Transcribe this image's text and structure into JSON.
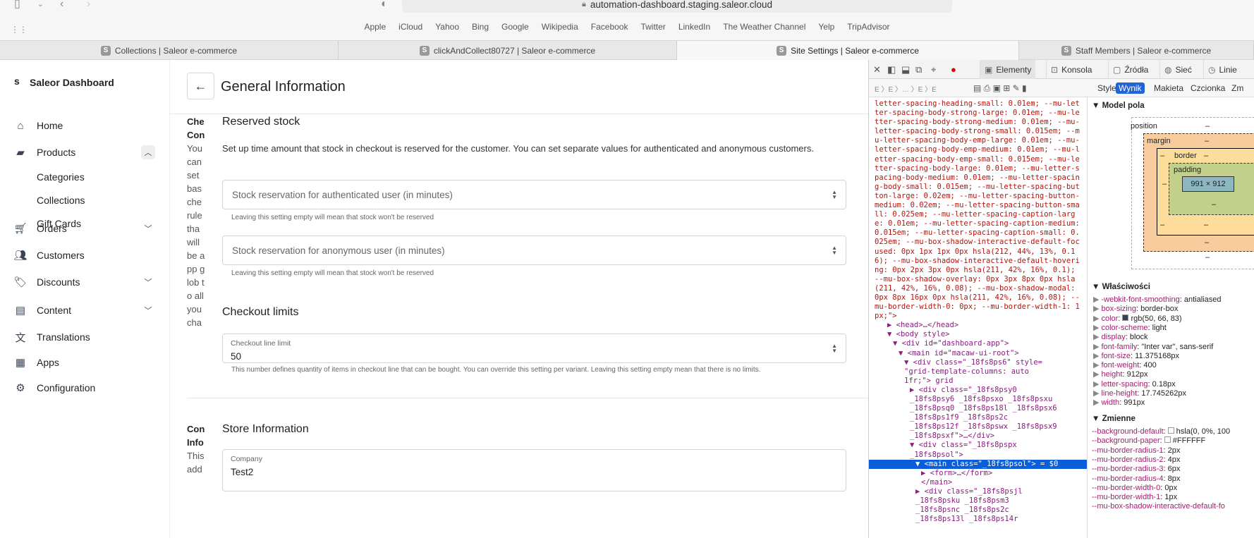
{
  "browser": {
    "url": "automation-dashboard.staging.saleor.cloud",
    "bookmarks": [
      "Apple",
      "iCloud",
      "Yahoo",
      "Bing",
      "Google",
      "Wikipedia",
      "Facebook",
      "Twitter",
      "LinkedIn",
      "The Weather Channel",
      "Yelp",
      "TripAdvisor"
    ],
    "tabs": [
      {
        "label": "Collections | Saleor e-commerce",
        "active": false
      },
      {
        "label": "clickAndCollect80727 | Saleor e-commerce",
        "active": false
      },
      {
        "label": "Site Settings | Saleor e-commerce",
        "active": true
      },
      {
        "label": "Staff Members | Saleor e-commerce",
        "active": false
      }
    ],
    "favicon_letter": "S"
  },
  "sidebar": {
    "brand": "Saleor Dashboard",
    "items": [
      {
        "label": "Home",
        "icon": "home-icon"
      },
      {
        "label": "Products",
        "icon": "folder-icon",
        "expanded": true
      },
      {
        "label": "Orders",
        "icon": "cart-icon"
      },
      {
        "label": "Customers",
        "icon": "users-icon"
      },
      {
        "label": "Discounts",
        "icon": "tag-icon"
      },
      {
        "label": "Content",
        "icon": "content-icon"
      },
      {
        "label": "Translations",
        "icon": "translate-icon"
      },
      {
        "label": "Apps",
        "icon": "apps-icon"
      },
      {
        "label": "Configuration",
        "icon": "gear-icon"
      }
    ],
    "subitems": [
      "Categories",
      "Collections",
      "Gift Cards"
    ]
  },
  "main": {
    "title": "General Information",
    "left_partial_1": {
      "heading": "Che Con",
      "body": "You can set bas che rule tha will be app glob to all you cha"
    },
    "left_partial_2": {
      "heading": "Con Info",
      "body": "This add"
    },
    "reserved": {
      "title": "Reserved stock",
      "desc": "Set up time amount that stock in checkout is reserved for the customer. You can set separate values for authenticated and anonymous customers.",
      "auth_placeholder": "Stock reservation for authenticated user (in minutes)",
      "anon_placeholder": "Stock reservation for anonymous user (in minutes)",
      "help": "Leaving this setting empty will mean that stock won't be reserved"
    },
    "limits": {
      "title": "Checkout limits",
      "label": "Checkout line limit",
      "value": "50",
      "help": "This number defines quantity of items in checkout line that can be bought. You can override this setting per variant. Leaving this setting empty mean that there is no limits."
    },
    "store": {
      "title": "Store Information",
      "company_label": "Company",
      "company_value": "Test2"
    }
  },
  "devtools": {
    "tabs": [
      "Elementy",
      "Konsola",
      "Źródła",
      "Sieć",
      "Linie"
    ],
    "panel_tabs": [
      "Style",
      "Wynik",
      "Makieta",
      "Czcionka",
      "Zm"
    ],
    "css_text": "letter-spacing-heading-small: 0.01em; --mu-letter-spacing-body-strong-large: 0.01em; --mu-letter-spacing-body-strong-medium: 0.01em; --mu-letter-spacing-body-strong-small: 0.015em; --mu-letter-spacing-body-emp-large: 0.01em; --mu-letter-spacing-body-emp-medium: 0.01em; --mu-letter-spacing-body-emp-small: 0.015em; --mu-letter-spacing-body-large: 0.01em; --mu-letter-spacing-body-medium: 0.01em; --mu-letter-spacing-body-small: 0.015em; --mu-letter-spacing-button-large: 0.02em; --mu-letter-spacing-button-medium: 0.02em; --mu-letter-spacing-button-small: 0.025em; --mu-letter-spacing-caption-large: 0.01em; --mu-letter-spacing-caption-medium: 0.015em; --mu-letter-spacing-caption-small: 0.025em; --mu-box-shadow-interactive-default-focused: 0px 1px 1px 0px hsla(212, 44%, 13%, 0.16); --mu-box-shadow-interactive-default-hovering: 0px 2px 3px 0px hsla(211, 42%, 16%, 0.1); --mu-box-shadow-overlay: 0px 3px 8px 0px hsla(211, 42%, 16%, 0.08); --mu-box-shadow-modal: 0px 8px 16px 0px hsla(211, 42%, 16%, 0.08); --mu-border-width-0: 0px; --mu-border-width-1: 1px;\">",
    "dom_lines": [
      {
        "text": "▶ <head>…</head>",
        "indent": 2,
        "sel": false
      },
      {
        "text": "▼ <body style>",
        "indent": 2,
        "sel": false
      },
      {
        "text": "▼ <div id=\"dashboard-app\">",
        "indent": 3,
        "sel": false
      },
      {
        "text": "▼ <main id=\"macaw-ui-root\">",
        "indent": 4,
        "sel": false
      },
      {
        "text": "▼ <div class=\"_18fs8ps6\" style=",
        "indent": 5,
        "sel": false
      },
      {
        "text": "\"grid-template-columns: auto",
        "indent": 5,
        "sel": false
      },
      {
        "text": "1fr;\"> grid",
        "indent": 5,
        "sel": false
      },
      {
        "text": "▶ <div class=\"_18fs8psy0",
        "indent": 6,
        "sel": false
      },
      {
        "text": "_18fs8psy6 _18fs8psxo _18fs8psxu",
        "indent": 6,
        "sel": false
      },
      {
        "text": "_18fs8psq0 _18fs8ps18l _18fs8psx6",
        "indent": 6,
        "sel": false
      },
      {
        "text": "_18fs8ps1f9 _18fs8ps2c",
        "indent": 6,
        "sel": false
      },
      {
        "text": "_18fs8ps12f _18fs8pswx _18fs8psx9",
        "indent": 6,
        "sel": false
      },
      {
        "text": "_18fs8psxf\">…</div>",
        "indent": 6,
        "sel": false
      },
      {
        "text": "▼ <div class=\"_18fs8pspx",
        "indent": 6,
        "sel": false
      },
      {
        "text": "_18fs8psol\">",
        "indent": 6,
        "sel": false
      },
      {
        "text": "▼ <main class=\"_18fs8psol\"> = $0",
        "indent": 7,
        "sel": true
      },
      {
        "text": "▶ <form>…</form>",
        "indent": 8,
        "sel": false
      },
      {
        "text": "</main>",
        "indent": 8,
        "sel": false
      },
      {
        "text": "▶ <div class=\"_18fs8psjl",
        "indent": 7,
        "sel": false
      },
      {
        "text": "_18fs8psku _18fs8psm3",
        "indent": 7,
        "sel": false
      },
      {
        "text": "_18fs8psnc _18fs8ps2c",
        "indent": 7,
        "sel": false
      },
      {
        "text": "_18fs8ps13l _18fs8ps14r",
        "indent": 7,
        "sel": false
      }
    ],
    "box_model": {
      "position": "position",
      "margin": "margin",
      "border": "border",
      "padding": "padding",
      "size": "991 × 912",
      "dash": "–"
    },
    "computed_title": "Właściwości",
    "box_title": "Model pola",
    "computed": [
      {
        "k": "-webkit-font-smoothing",
        "v": "antialiased"
      },
      {
        "k": "box-sizing",
        "v": "border-box"
      },
      {
        "k": "color",
        "v": "rgb(50, 66, 83)"
      },
      {
        "k": "color-scheme",
        "v": "light"
      },
      {
        "k": "display",
        "v": "block"
      },
      {
        "k": "font-family",
        "v": "\"Inter var\", sans-serif"
      },
      {
        "k": "font-size",
        "v": "11.375168px"
      },
      {
        "k": "font-weight",
        "v": "400"
      },
      {
        "k": "height",
        "v": "912px"
      },
      {
        "k": "letter-spacing",
        "v": "0.18px"
      },
      {
        "k": "line-height",
        "v": "17.745262px"
      },
      {
        "k": "width",
        "v": "991px"
      }
    ],
    "vars_title": "Zmienne",
    "vars": [
      {
        "k": "--background-default",
        "v": "hsla(0, 0%, 100"
      },
      {
        "k": "--background-paper",
        "v": "#FFFFFF"
      },
      {
        "k": "--mu-border-radius-1",
        "v": "2px"
      },
      {
        "k": "--mu-border-radius-2",
        "v": "4px"
      },
      {
        "k": "--mu-border-radius-3",
        "v": "6px"
      },
      {
        "k": "--mu-border-radius-4",
        "v": "8px"
      },
      {
        "k": "--mu-border-width-0",
        "v": "0px"
      },
      {
        "k": "--mu-border-width-1",
        "v": "1px"
      },
      {
        "k": "--mu-box-shadow-interactive-default-fo",
        "v": ""
      }
    ]
  }
}
